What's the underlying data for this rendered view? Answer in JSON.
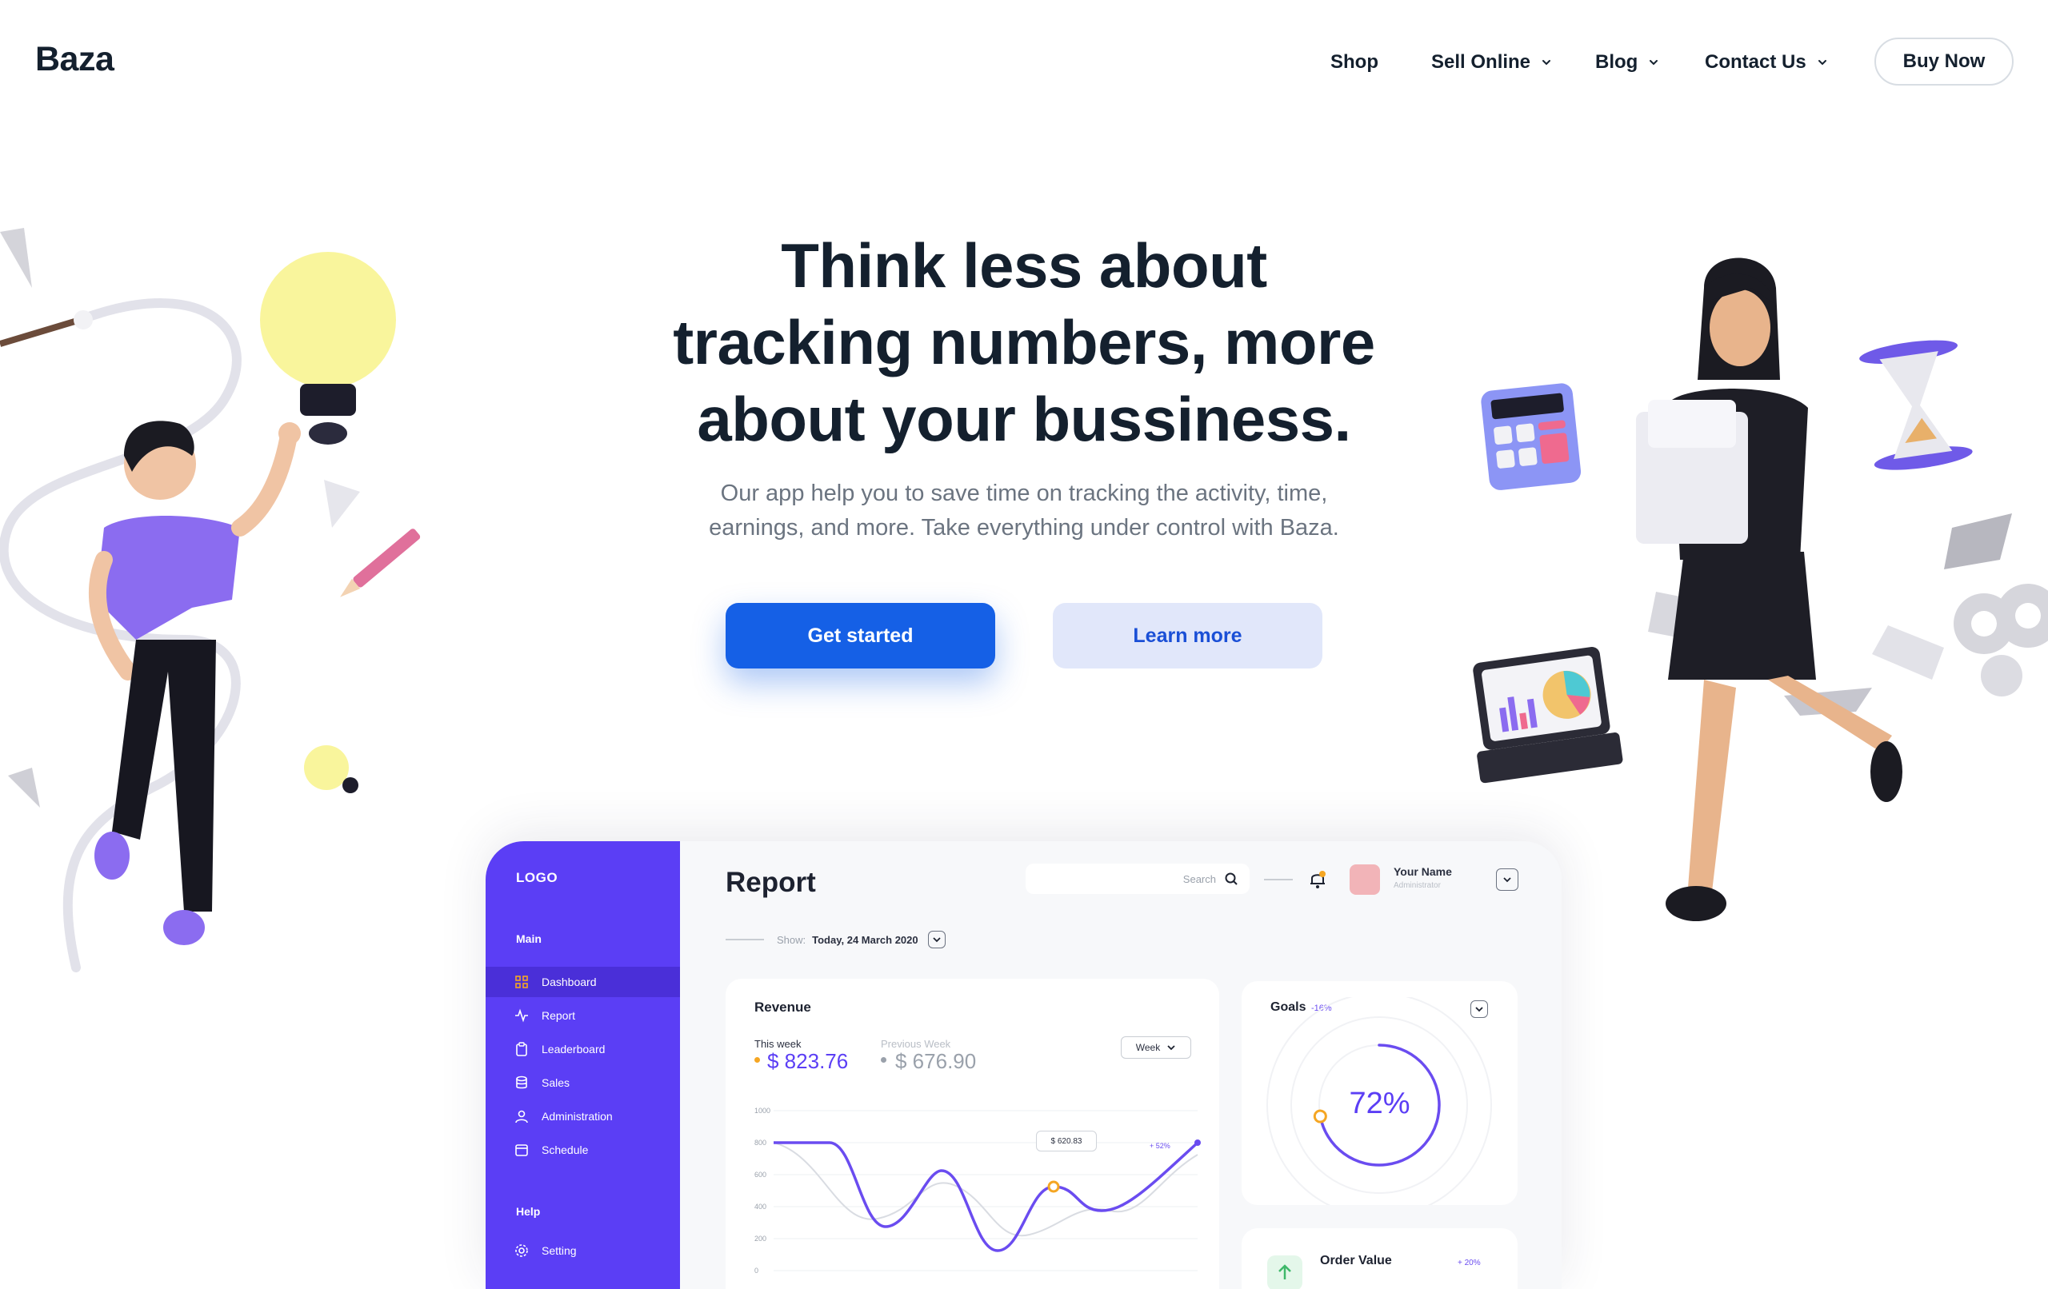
{
  "brand": {
    "name": "Baza"
  },
  "nav": {
    "items": [
      {
        "label": "Shop",
        "has_dropdown": false
      },
      {
        "label": "Sell Online",
        "has_dropdown": true
      },
      {
        "label": "Blog",
        "has_dropdown": true
      },
      {
        "label": "Contact Us",
        "has_dropdown": true
      }
    ],
    "cta": "Buy Now"
  },
  "hero": {
    "headline_lines": [
      "Think less about",
      "tracking numbers, more",
      "about your bussiness."
    ],
    "subtitle_lines": [
      "Our app help you to save time on tracking the activity, time,",
      "earnings, and more. Take everything under control with Baza."
    ],
    "primary_button": "Get started",
    "secondary_button": "Learn more"
  },
  "dashboard": {
    "logo": "LOGO",
    "sections": {
      "main": "Main",
      "help": "Help"
    },
    "menu": [
      {
        "label": "Dashboard",
        "icon": "grid-icon",
        "active": true
      },
      {
        "label": "Report",
        "icon": "pulse-icon",
        "active": false
      },
      {
        "label": "Leaderboard",
        "icon": "clipboard-icon",
        "active": false
      },
      {
        "label": "Sales",
        "icon": "database-icon",
        "active": false
      },
      {
        "label": "Administration",
        "icon": "user-icon",
        "active": false
      },
      {
        "label": "Schedule",
        "icon": "calendar-icon",
        "active": false
      }
    ],
    "help_menu": [
      {
        "label": "Setting",
        "icon": "gear-icon"
      }
    ],
    "title": "Report",
    "search_placeholder": "Search",
    "show_label": "Show:",
    "show_value": "Today, 24 March 2020",
    "user": {
      "name": "Your Name",
      "role": "Administrator"
    },
    "revenue": {
      "title": "Revenue",
      "this_week_label": "This week",
      "this_week_value": "$ 823.76",
      "prev_week_label": "Previous Week",
      "prev_week_value": "$ 676.90",
      "period": "Week",
      "tooltip": "$ 620.83",
      "change": "+ 52%",
      "y_ticks": [
        "1000",
        "800",
        "600",
        "400",
        "200",
        "0"
      ]
    },
    "goals": {
      "title": "Goals",
      "change": "-16%",
      "percent_label": "72%",
      "percent": 0.72
    },
    "order_value": {
      "title": "Order Value",
      "change": "+ 20%"
    }
  },
  "colors": {
    "primary": "#1560e6",
    "secondary_bg": "#e1e7fa",
    "dashboard_sidebar": "#5b3ef5",
    "text_dark": "#14202e",
    "text_muted": "#6b7480",
    "chart_line": "#6a4cf0",
    "accent_orange": "#f5a623"
  }
}
